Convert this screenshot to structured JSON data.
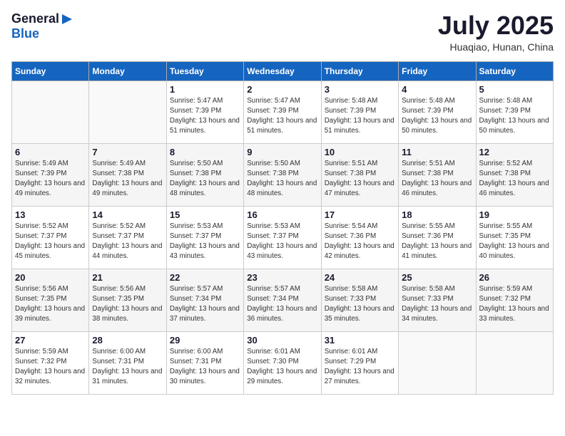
{
  "header": {
    "logo_general": "General",
    "logo_blue": "Blue",
    "title": "July 2025",
    "location": "Huaqiao, Hunan, China"
  },
  "days_of_week": [
    "Sunday",
    "Monday",
    "Tuesday",
    "Wednesday",
    "Thursday",
    "Friday",
    "Saturday"
  ],
  "weeks": [
    [
      {
        "day": "",
        "info": ""
      },
      {
        "day": "",
        "info": ""
      },
      {
        "day": "1",
        "info": "Sunrise: 5:47 AM\nSunset: 7:39 PM\nDaylight: 13 hours and 51 minutes."
      },
      {
        "day": "2",
        "info": "Sunrise: 5:47 AM\nSunset: 7:39 PM\nDaylight: 13 hours and 51 minutes."
      },
      {
        "day": "3",
        "info": "Sunrise: 5:48 AM\nSunset: 7:39 PM\nDaylight: 13 hours and 51 minutes."
      },
      {
        "day": "4",
        "info": "Sunrise: 5:48 AM\nSunset: 7:39 PM\nDaylight: 13 hours and 50 minutes."
      },
      {
        "day": "5",
        "info": "Sunrise: 5:48 AM\nSunset: 7:39 PM\nDaylight: 13 hours and 50 minutes."
      }
    ],
    [
      {
        "day": "6",
        "info": "Sunrise: 5:49 AM\nSunset: 7:39 PM\nDaylight: 13 hours and 49 minutes."
      },
      {
        "day": "7",
        "info": "Sunrise: 5:49 AM\nSunset: 7:38 PM\nDaylight: 13 hours and 49 minutes."
      },
      {
        "day": "8",
        "info": "Sunrise: 5:50 AM\nSunset: 7:38 PM\nDaylight: 13 hours and 48 minutes."
      },
      {
        "day": "9",
        "info": "Sunrise: 5:50 AM\nSunset: 7:38 PM\nDaylight: 13 hours and 48 minutes."
      },
      {
        "day": "10",
        "info": "Sunrise: 5:51 AM\nSunset: 7:38 PM\nDaylight: 13 hours and 47 minutes."
      },
      {
        "day": "11",
        "info": "Sunrise: 5:51 AM\nSunset: 7:38 PM\nDaylight: 13 hours and 46 minutes."
      },
      {
        "day": "12",
        "info": "Sunrise: 5:52 AM\nSunset: 7:38 PM\nDaylight: 13 hours and 46 minutes."
      }
    ],
    [
      {
        "day": "13",
        "info": "Sunrise: 5:52 AM\nSunset: 7:37 PM\nDaylight: 13 hours and 45 minutes."
      },
      {
        "day": "14",
        "info": "Sunrise: 5:52 AM\nSunset: 7:37 PM\nDaylight: 13 hours and 44 minutes."
      },
      {
        "day": "15",
        "info": "Sunrise: 5:53 AM\nSunset: 7:37 PM\nDaylight: 13 hours and 43 minutes."
      },
      {
        "day": "16",
        "info": "Sunrise: 5:53 AM\nSunset: 7:37 PM\nDaylight: 13 hours and 43 minutes."
      },
      {
        "day": "17",
        "info": "Sunrise: 5:54 AM\nSunset: 7:36 PM\nDaylight: 13 hours and 42 minutes."
      },
      {
        "day": "18",
        "info": "Sunrise: 5:55 AM\nSunset: 7:36 PM\nDaylight: 13 hours and 41 minutes."
      },
      {
        "day": "19",
        "info": "Sunrise: 5:55 AM\nSunset: 7:35 PM\nDaylight: 13 hours and 40 minutes."
      }
    ],
    [
      {
        "day": "20",
        "info": "Sunrise: 5:56 AM\nSunset: 7:35 PM\nDaylight: 13 hours and 39 minutes."
      },
      {
        "day": "21",
        "info": "Sunrise: 5:56 AM\nSunset: 7:35 PM\nDaylight: 13 hours and 38 minutes."
      },
      {
        "day": "22",
        "info": "Sunrise: 5:57 AM\nSunset: 7:34 PM\nDaylight: 13 hours and 37 minutes."
      },
      {
        "day": "23",
        "info": "Sunrise: 5:57 AM\nSunset: 7:34 PM\nDaylight: 13 hours and 36 minutes."
      },
      {
        "day": "24",
        "info": "Sunrise: 5:58 AM\nSunset: 7:33 PM\nDaylight: 13 hours and 35 minutes."
      },
      {
        "day": "25",
        "info": "Sunrise: 5:58 AM\nSunset: 7:33 PM\nDaylight: 13 hours and 34 minutes."
      },
      {
        "day": "26",
        "info": "Sunrise: 5:59 AM\nSunset: 7:32 PM\nDaylight: 13 hours and 33 minutes."
      }
    ],
    [
      {
        "day": "27",
        "info": "Sunrise: 5:59 AM\nSunset: 7:32 PM\nDaylight: 13 hours and 32 minutes."
      },
      {
        "day": "28",
        "info": "Sunrise: 6:00 AM\nSunset: 7:31 PM\nDaylight: 13 hours and 31 minutes."
      },
      {
        "day": "29",
        "info": "Sunrise: 6:00 AM\nSunset: 7:31 PM\nDaylight: 13 hours and 30 minutes."
      },
      {
        "day": "30",
        "info": "Sunrise: 6:01 AM\nSunset: 7:30 PM\nDaylight: 13 hours and 29 minutes."
      },
      {
        "day": "31",
        "info": "Sunrise: 6:01 AM\nSunset: 7:29 PM\nDaylight: 13 hours and 27 minutes."
      },
      {
        "day": "",
        "info": ""
      },
      {
        "day": "",
        "info": ""
      }
    ]
  ]
}
